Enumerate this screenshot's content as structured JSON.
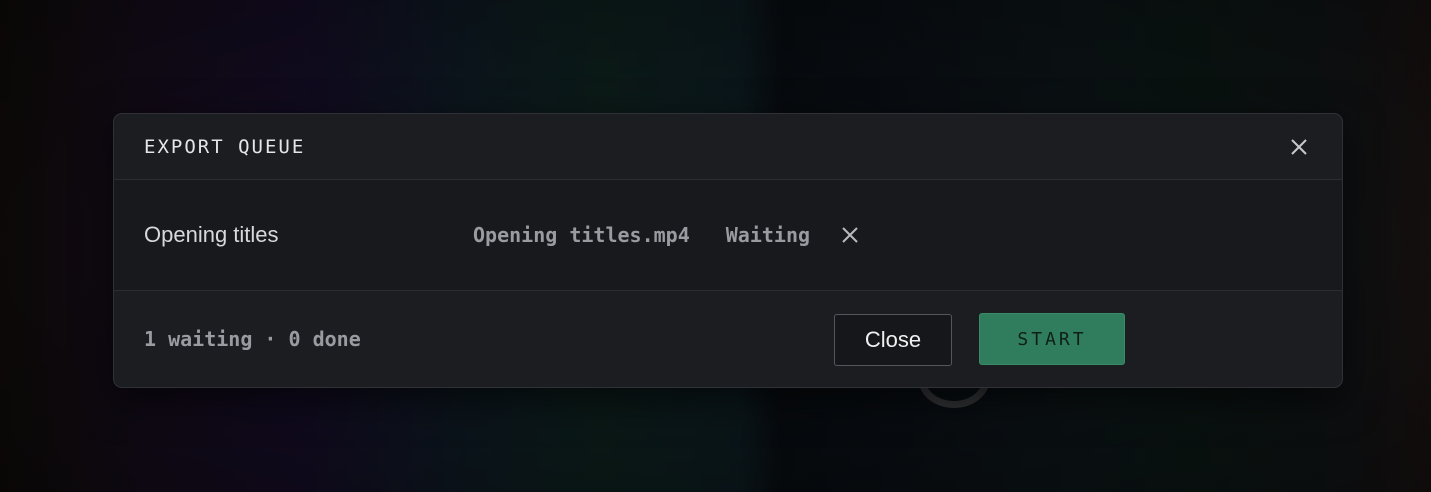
{
  "dialog": {
    "title": "EXPORT QUEUE",
    "close_icon": "close-icon"
  },
  "queue": {
    "items": [
      {
        "name": "Opening titles",
        "file": "Opening titles.mp4",
        "status": "Waiting",
        "remove_icon": "close-icon"
      }
    ]
  },
  "footer": {
    "summary": "1 waiting · 0 done",
    "close_label": "Close",
    "start_label": "START"
  },
  "colors": {
    "accent": "#2f7d5c",
    "panel": "#1c1d21",
    "muted_text": "#9a9ba1"
  }
}
